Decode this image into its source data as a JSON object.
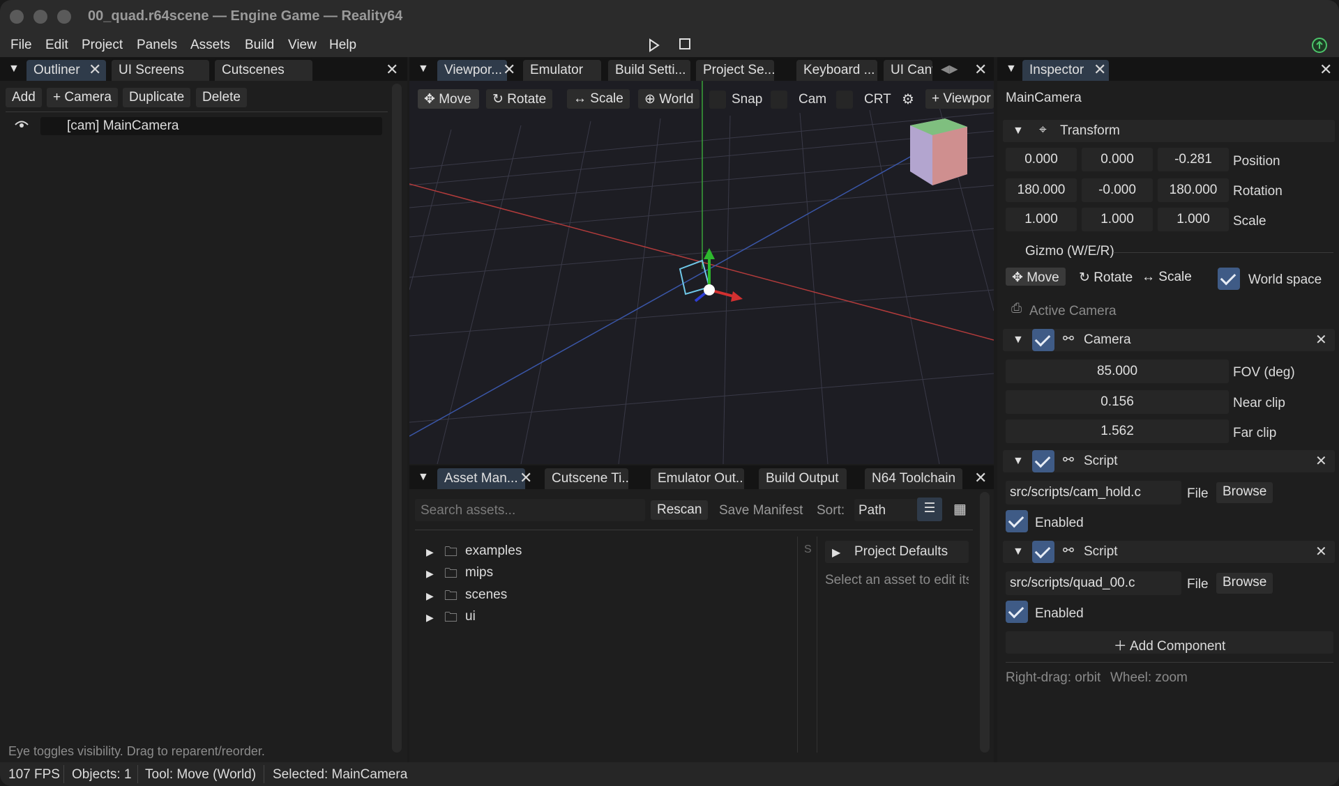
{
  "window": {
    "title": "00_quad.r64scene — Engine Game — Reality64"
  },
  "menubar": {
    "items": [
      "File",
      "Edit",
      "Project",
      "Panels",
      "Assets",
      "Build",
      "View",
      "Help"
    ]
  },
  "outliner": {
    "tabs": [
      "Outliner",
      "UI Screens",
      "Cutscenes"
    ],
    "toolbar": [
      "Add",
      "+ Camera",
      "Duplicate",
      "Delete"
    ],
    "items": [
      {
        "label": "[cam] MainCamera"
      }
    ],
    "hint": "Eye toggles visibility. Drag to reparent/reorder."
  },
  "viewport": {
    "tabs": [
      "Viewpor...",
      "Emulator",
      "Build Setti...",
      "Project Se...",
      "Keyboard ...",
      "UI Canv"
    ],
    "toolbar": {
      "move": "Move",
      "rotate": "Rotate",
      "scale": "Scale",
      "world": "World",
      "snap": "Snap",
      "cam": "Cam",
      "crt": "CRT",
      "add_viewport": "+ Viewpor"
    }
  },
  "assets": {
    "tabs": [
      "Asset Man...",
      "Cutscene Ti...",
      "Emulator Out...",
      "Build Output",
      "N64 Toolchain"
    ],
    "search_placeholder": "Search assets...",
    "rescan": "Rescan",
    "save_manifest": "Save Manifest",
    "sort_label": "Sort:",
    "sort_value": "Path",
    "folders": [
      "examples",
      "mips",
      "scenes",
      "ui"
    ],
    "col_s": "S",
    "project_defaults": "Project Defaults",
    "select_hint": "Select an asset to edit its"
  },
  "inspector": {
    "tab": "Inspector",
    "object_name": "MainCamera",
    "transform": {
      "title": "Transform",
      "position": {
        "label": "Position",
        "values": [
          "0.000",
          "0.000",
          "-0.281"
        ]
      },
      "rotation": {
        "label": "Rotation",
        "values": [
          "180.000",
          "-0.000",
          "180.000"
        ]
      },
      "scale": {
        "label": "Scale",
        "values": [
          "1.000",
          "1.000",
          "1.000"
        ]
      }
    },
    "gizmo": {
      "label": "Gizmo (W/E/R)",
      "move": "Move",
      "rotate": "Rotate",
      "scale": "Scale",
      "world_space": "World space",
      "world_space_checked": true
    },
    "active_camera": "Active Camera",
    "camera": {
      "title": "Camera",
      "enabled": true,
      "fov": {
        "value": "85.000",
        "label": "FOV (deg)"
      },
      "near": {
        "value": "0.156",
        "label": "Near clip"
      },
      "far": {
        "value": "1.562",
        "label": "Far clip"
      }
    },
    "scripts": [
      {
        "title": "Script",
        "path": "src/scripts/cam_hold.c",
        "file": "File",
        "browse": "Browse",
        "enabled_label": "Enabled",
        "enabled": true
      },
      {
        "title": "Script",
        "path": "src/scripts/quad_00.c",
        "file": "File",
        "browse": "Browse",
        "enabled_label": "Enabled",
        "enabled": true
      }
    ],
    "add_component": "Add Component",
    "hint_orbit": "Right-drag: orbit",
    "hint_zoom": "Wheel: zoom"
  },
  "status": {
    "fps": "107 FPS",
    "objects": "Objects: 1",
    "tool": "Tool: Move (World)",
    "selected": "Selected: MainCamera"
  },
  "colors": {
    "accent": "#3f5b86",
    "background": "#1e1e1e",
    "x_axis": "#c03a3a",
    "y_axis": "#3aa43a",
    "z_axis": "#3a5fc0"
  }
}
